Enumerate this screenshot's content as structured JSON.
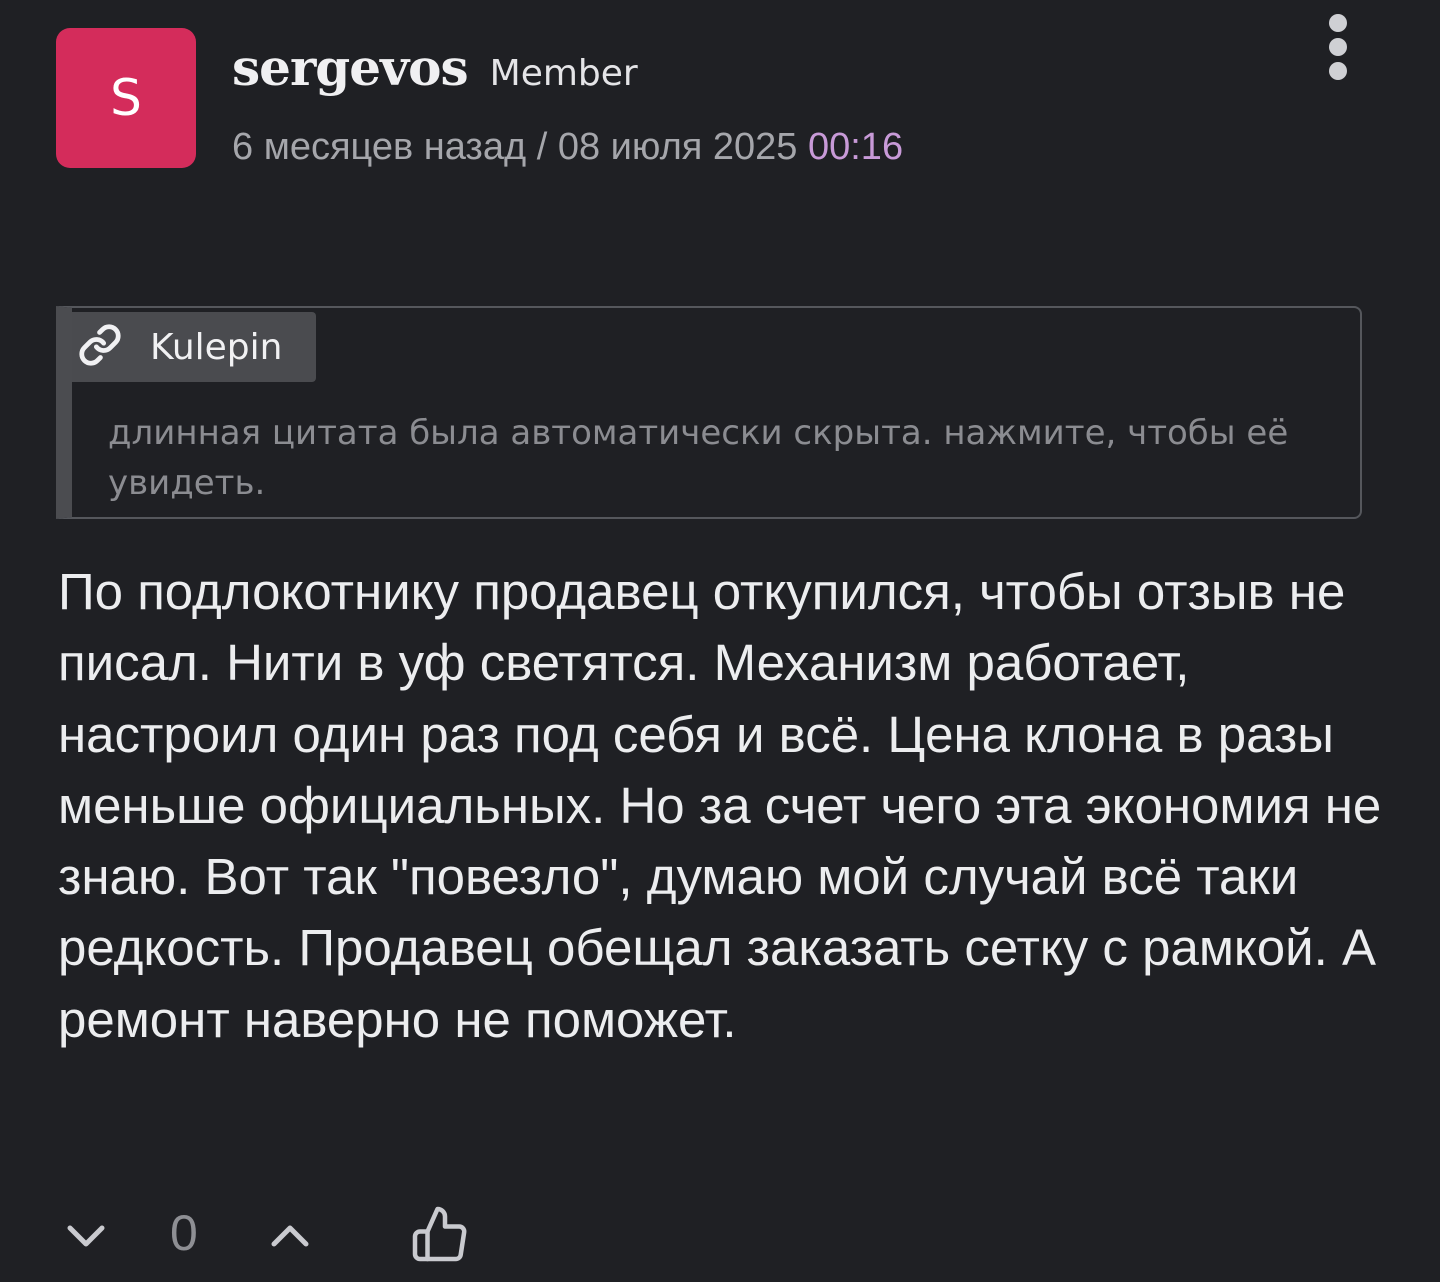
{
  "post": {
    "avatar_letter": "S",
    "author": {
      "username": "sergevos",
      "role": "Member"
    },
    "meta": {
      "relative_time": "6 месяцев назад",
      "separator": "/",
      "date": "08 июля 2025",
      "time": "00:16"
    },
    "menu_icon": "more-vertical-icon",
    "quote": {
      "icon": "link-icon",
      "source": "Kulepin",
      "hidden_notice": "длинная цитата была автоматически скрыта. нажмите, чтобы её увидеть."
    },
    "body": "По подлокотнику продавец откупился, чтобы отзыв не писал. Нити в уф светятся. Механизм работает, настроил один раз под себя и всё. Цена клона в разы меньше официальных. Но за счет чего эта экономия не знаю. Вот так \"повезло\", думаю мой случай всё таки редкость. Продавец обещал заказать сетку с рамкой. А ремонт наверно не поможет.",
    "votes": {
      "count": "0",
      "down_icon": "chevron-down-icon",
      "up_icon": "chevron-up-icon",
      "like_icon": "thumbs-up-icon"
    }
  },
  "colors": {
    "background": "#1f2024",
    "avatar": "#d42c5b",
    "time_accent": "#c89ad8",
    "muted_text": "#a5a6ab"
  }
}
